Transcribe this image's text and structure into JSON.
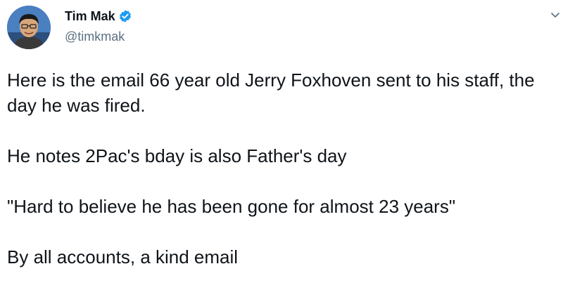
{
  "author": {
    "display_name": "Tim Mak",
    "handle": "@timkmak",
    "verified": true
  },
  "icons": {
    "verified": "verified-badge-icon",
    "more": "chevron-down-icon"
  },
  "colors": {
    "verified_blue": "#1d9bf0",
    "handle_gray": "#5b7083",
    "text": "#0f1419"
  },
  "tweet": {
    "paragraphs": [
      "Here is the email 66 year old Jerry Foxhoven sent to his staff, the day he was fired.",
      "He notes 2Pac's bday is also Father's day",
      "\"Hard to believe he has been gone for almost 23 years\"",
      "By all accounts, a kind email"
    ]
  }
}
